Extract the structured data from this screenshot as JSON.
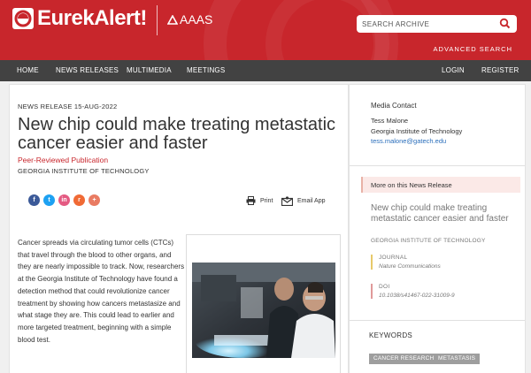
{
  "header": {
    "logo_text": "EurekAlert!",
    "partner_text": "AAAS",
    "search_placeholder": "SEARCH ARCHIVE",
    "advanced_search": "ADVANCED SEARCH",
    "brand_color": "#c8262c"
  },
  "nav": {
    "left": [
      "HOME",
      "NEWS RELEASES",
      "MULTIMEDIA",
      "MEETINGS"
    ],
    "right": [
      "LOGIN",
      "REGISTER"
    ]
  },
  "article": {
    "kicker": "NEWS RELEASE 15-AUG-2022",
    "title": "New chip could make treating metastatic cancer easier and faster",
    "peer_reviewed": "Peer-Reviewed Publication",
    "organization": "GEORGIA INSTITUTE OF TECHNOLOGY",
    "share_icons": [
      "facebook-icon",
      "twitter-icon",
      "linkedin-icon",
      "reddit-icon",
      "more-share-icon"
    ],
    "print_label": "Print",
    "email_label": "Email App",
    "body": "Cancer spreads via circulating tumor cells (CTCs) that travel through the blood to other organs, and they are nearly impossible to track. Now, researchers at the Georgia Institute of Technology have found a detection method that could revolutionize cancer treatment by showing how cancers metastasize and what stage they are. This could lead to earlier and more targeted treatment, beginning with a simple blood test."
  },
  "sidebar": {
    "media_contact": {
      "heading": "Media Contact",
      "name": "Tess Malone",
      "org": "Georgia Institute of Technology",
      "email": "tess.malone@gatech.edu"
    },
    "more_heading": "More on this News Release",
    "related_title": "New chip could make treating metastatic cancer easier and faster",
    "related_org": "GEORGIA INSTITUTE OF TECHNOLOGY",
    "journal_label": "JOURNAL",
    "journal_value": "Nature Communications",
    "doi_label": "DOI",
    "doi_value": "10.1038/s41467-022-31009-9",
    "keywords_heading": "KEYWORDS",
    "keywords": [
      "CANCER RESEARCH",
      "METASTASIS"
    ]
  }
}
